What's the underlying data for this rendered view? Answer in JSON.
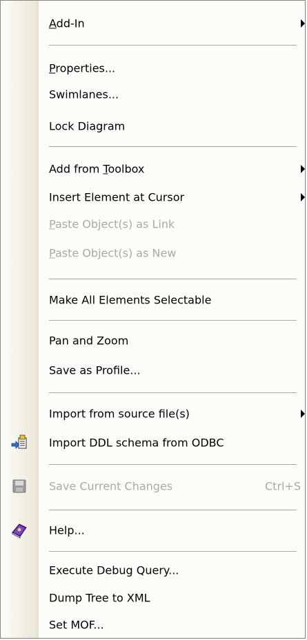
{
  "menu": {
    "add_in": {
      "label": "Add-In",
      "access_key": "A",
      "rest": "dd-In"
    },
    "properties": {
      "label": "Properties...",
      "access_key": "P",
      "rest": "roperties..."
    },
    "swimlanes": {
      "label": "Swimlanes..."
    },
    "lock_diagram": {
      "label": "Lock Diagram"
    },
    "add_from_toolbox": {
      "pre": "Add from ",
      "access_key": "T",
      "rest": "oolbox"
    },
    "insert_element": {
      "label": "Insert Element at Cursor"
    },
    "paste_link": {
      "access_key": "P",
      "rest": "aste Object(s) as Link"
    },
    "paste_new": {
      "access_key": "P",
      "rest": "aste Object(s) as New"
    },
    "make_selectable": {
      "label": "Make All Elements Selectable"
    },
    "pan_zoom": {
      "label": "Pan and Zoom"
    },
    "save_profile": {
      "label": "Save as Profile..."
    },
    "import_source": {
      "label": "Import from source file(s)"
    },
    "import_ddl": {
      "label": "Import DDL schema from ODBC"
    },
    "save_changes": {
      "label": "Save Current Changes",
      "shortcut": "Ctrl+S"
    },
    "help": {
      "label": "Help..."
    },
    "debug_query": {
      "label": "Execute Debug Query..."
    },
    "dump_tree": {
      "label": "Dump Tree to XML"
    },
    "set_mof": {
      "label": "Set MOF..."
    }
  },
  "colors": {
    "disabled_text": "#acaa99",
    "gutter": "#ece9d8",
    "separator": "#aca899"
  },
  "icons": [
    "import-ddl-icon",
    "save-disk-icon",
    "help-book-icon"
  ]
}
